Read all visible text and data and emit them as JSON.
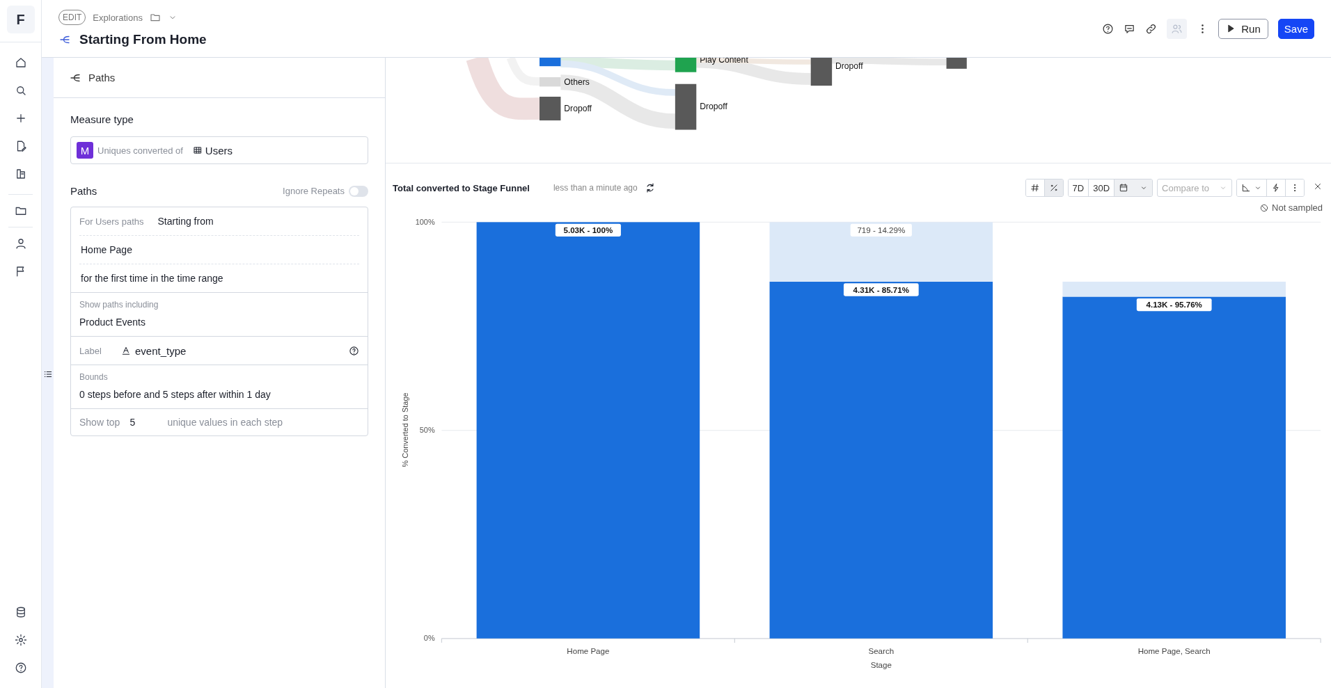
{
  "rail": {
    "logo": "F"
  },
  "header": {
    "badge": "EDIT",
    "breadcrumb": "Explorations",
    "title": "Starting From Home",
    "buttons": [
      {
        "kind": "run",
        "label": "Run"
      },
      {
        "kind": "save",
        "label": "Save"
      }
    ]
  },
  "panel": {
    "title": "Paths",
    "measure": {
      "heading": "Measure type",
      "badge": "M",
      "text": "Uniques converted of",
      "entity": "Users"
    },
    "paths": {
      "heading": "Paths",
      "ignore_repeats": {
        "label": "Ignore Repeats",
        "on": false
      },
      "for_label": "For Users paths",
      "start_mode": "Starting from",
      "start_event": "Home Page",
      "start_condition": "for the first time in the time range",
      "include_label": "Show paths including",
      "include_value": "Product Events",
      "label_label": "Label",
      "label_value": "event_type",
      "bounds_label": "Bounds",
      "bounds_value": "0 steps before and 5 steps after within 1 day",
      "show_top_label": "Show top",
      "show_top_value": "5",
      "show_top_suffix": "unique values in each step"
    }
  },
  "sankey": {
    "nodes": [
      {
        "color": "#1a6fdc"
      },
      {
        "label": "Others",
        "color": "#d9d9d9"
      },
      {
        "label": "Dropoff",
        "color": "#595959"
      },
      {
        "label": "Play Content",
        "color": "#1fa34f"
      },
      {
        "label": "Dropoff",
        "color": "#595959"
      },
      {
        "label": "Dropoff",
        "color": "#595959"
      },
      {
        "color": "#595959"
      }
    ]
  },
  "chart_panel": {
    "title": "Total converted to Stage Funnel",
    "updated": "less than a minute ago",
    "modes": [
      {
        "kind": "count",
        "selected": false
      },
      {
        "kind": "percent",
        "selected": true
      }
    ],
    "ranges": [
      {
        "label": "7D"
      },
      {
        "label": "30D"
      }
    ],
    "compare_placeholder": "Compare to",
    "sampling": "Not sampled",
    "chart_data": {
      "type": "bar",
      "stacked": true,
      "xlabel": "Stage",
      "ylabel": "% Converted to Stage",
      "categories": [
        "Home Page",
        "Search",
        "Home Page, Search"
      ],
      "ylim": [
        0,
        100
      ],
      "yticks": [
        {
          "value": 0,
          "label": "0%"
        },
        {
          "value": 50,
          "label": "50%"
        },
        {
          "value": 100,
          "label": "100%"
        }
      ],
      "series": [
        {
          "color": "#1a6fdc",
          "values": [
            100,
            85.7,
            82.1
          ]
        },
        {
          "color": "#dce9f8",
          "values": [
            0,
            14.3,
            3.6
          ]
        }
      ],
      "value_labels": [
        [
          "5.03K - 100%",
          "4.31K - 85.71%",
          "4.13K - 95.76%"
        ],
        [
          null,
          "719 - 14.29%",
          null
        ]
      ]
    }
  }
}
